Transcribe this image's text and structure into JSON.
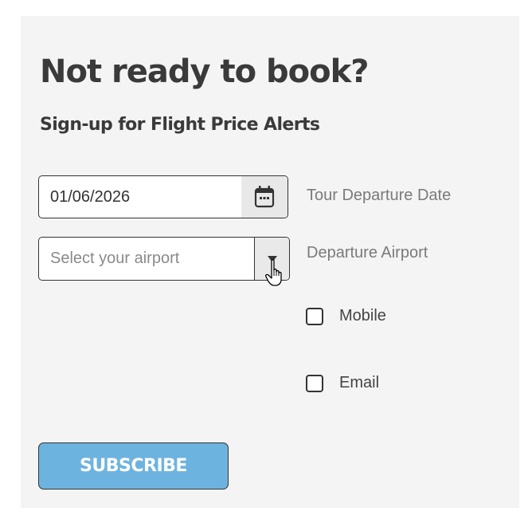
{
  "form": {
    "title": "Not ready to book?",
    "subtitle": "Sign-up for Flight Price Alerts",
    "date_field": {
      "value": "01/06/2026",
      "label": "Tour Departure Date",
      "icon": "calendar-icon"
    },
    "airport_field": {
      "placeholder": "Select your airport",
      "label": "Departure Airport",
      "icon": "caret-down-icon"
    },
    "checkboxes": [
      {
        "label": "Mobile",
        "checked": false
      },
      {
        "label": "Email",
        "checked": false
      }
    ],
    "subscribe_label": "SUBSCRIBE"
  },
  "colors": {
    "panel_bg": "#f4f4f4",
    "button_bg": "#6db3df",
    "text_dark": "#3a3a3a",
    "text_muted": "#7a7a7a"
  }
}
